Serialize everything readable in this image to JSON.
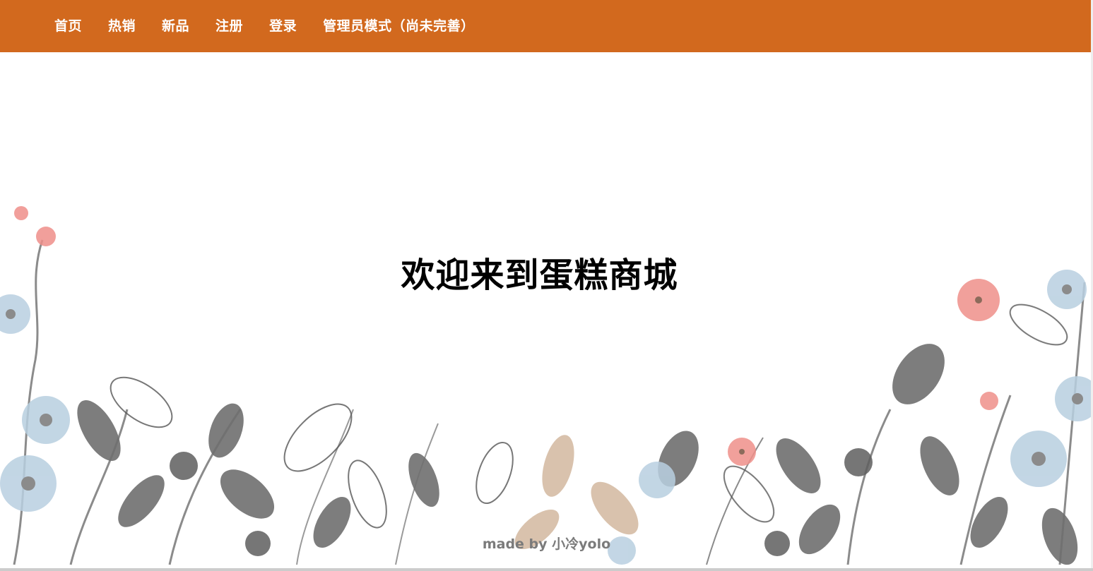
{
  "nav": {
    "items": [
      {
        "label": "首页"
      },
      {
        "label": "热销"
      },
      {
        "label": "新品"
      },
      {
        "label": "注册"
      },
      {
        "label": "登录"
      },
      {
        "label": "管理员模式（尚未完善）"
      }
    ]
  },
  "main": {
    "welcome_title": "欢迎来到蛋糕商城"
  },
  "footer": {
    "credit": "made by 小冷yolo"
  },
  "colors": {
    "navbar_bg": "#d2691e",
    "nav_text": "#ffffff",
    "title_text": "#000000",
    "footer_text": "#7b7b7b"
  },
  "decoration": {
    "background_image": "watercolor-floral-border"
  }
}
